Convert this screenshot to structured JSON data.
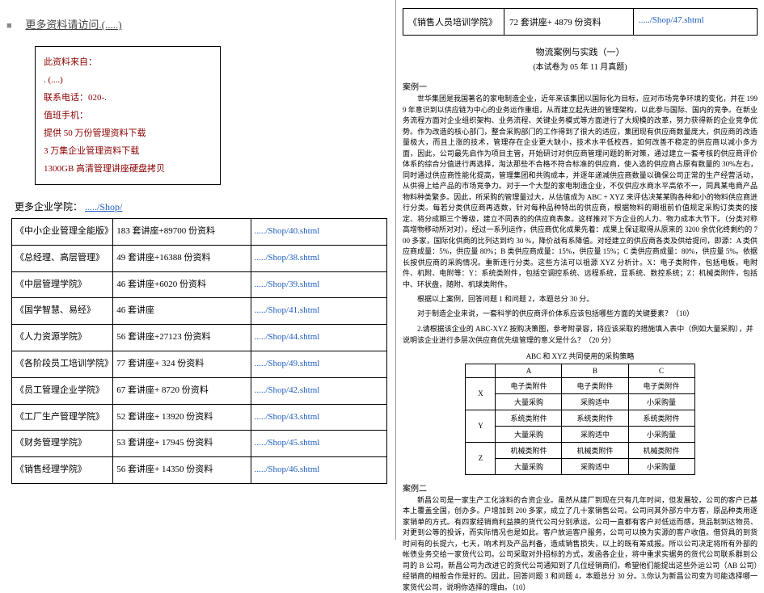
{
  "left": {
    "more": "更多资料请访问.(.....)",
    "info": [
      "此资料来自：",
      ". (....)",
      "联系电话：020-.",
      "值班手机：",
      "提供 50 万份管理资料下载",
      "3 万集企业管理资料下载",
      "1300GB 高清管理讲座硬盘拷贝"
    ],
    "shop_header_pre": "更多企业学院：",
    "shop_header_link": "...../Shop/",
    "rows": [
      {
        "a": "《中小企业管理全能版》",
        "b": "183 套讲座+89700 份资料",
        "c": "...../Shop/40.shtml"
      },
      {
        "a": "《总经理、高层管理》",
        "b": "49 套讲座+16388 份资料",
        "c": "...../Shop/38.shtml"
      },
      {
        "a": "《中层管理学院》",
        "b": "46 套讲座+6020 份资料",
        "c": "...../Shop/39.shtml"
      },
      {
        "a": "《国学智慧、易经》",
        "b": "46 套讲座",
        "c": "...../Shop/41.shtml"
      },
      {
        "a": "《人力资源学院》",
        "b": "56 套讲座+27123 份资料",
        "c": "...../Shop/44.shtml"
      },
      {
        "a": "《各阶段员工培训学院》",
        "b": "77 套讲座+ 324 份资料",
        "c": "...../Shop/49.shtml"
      },
      {
        "a": "《员工管理企业学院》",
        "b": "67 套讲座+ 8720 份资料",
        "c": "...../Shop/42.shtml"
      },
      {
        "a": "《工厂生产管理学院》",
        "b": "52 套讲座+ 13920 份资料",
        "c": "...../Shop/43.shtml"
      },
      {
        "a": "《财务管理学院》",
        "b": "53 套讲座+ 17945 份资料",
        "c": "...../Shop/45.shtml"
      },
      {
        "a": "《销售经理学院》",
        "b": "56 套讲座+ 14350 份资料",
        "c": "...../Shop/46.shtml"
      }
    ]
  },
  "right": {
    "top": {
      "a": "《销售人员培训学院》",
      "b": "72 套讲座+ 4879 份资料",
      "c": "...../Shop/47.shtml"
    },
    "title": "物流案例与实践（一）",
    "sub": "(本试卷为 05 年 11 月真题)",
    "case1_label": "案例一",
    "case1_text": "世华集团是我国著名的家电制造企业，近年来该集团以国际化为目标，应对市场竞争环境的变化，并在 1999 年意识到以供应链为中心的业务运作重组，从而建立起先进的管理架构，以此参与国际、国内的竞争。在新业务流程方面对企业组织架构、业务流程、关键业务模式等方面进行了大规模的改革，努力获得新的企业竞争优势。作为改造的核心部门，整合采购部门的工作得到了很大的适应，集团现有供应商数量庞大，供应商的改造量极大，而且上涨的技术，管理存在企业更大缺小，技术水平低校西，如何改善不稳定的供应商以减小多方面，因此，公司最先启作为项目主管，开始研讨对供应商管理问题的新对策，通过建立一套考核的供应商评价体系的综合分值进行再选择，淘汰那些不合格不符合标准的供应商，使入选的供应商占原有数量的 30%左右，同时通过供应商性能化提高，管理集团和共购成本，并逐年递减供应商数量以确保公司正常的生产经营活动，从供得上给产品的市场竞争力。对于一个大型的家电制造企业，不仅供应水商水平高依不一，同具某电商产品物料种类繁多。因此，所采购的管理量过大，从估值成为 ABC + XYZ 来评估决某某购各种和小的物料供应商进行分类。每若分类供应商再选数，针对每种品种特出的供应商，根据物料的期祖前价值规定采购订类类的接定、将分成期三个等级，建立不同表的的供应商表象。这样推对下方企业的人力、物力成本大节下。（分类对称高增物移动所对对）。经过一系列运作，供应商优化成果先着：成果上保证取得从原来的 3200 余优化终剩约的 700 多家，国际化供商的比列达到约 30 %，降价战有系降值。对经建立的供应商各类及供给提问，即源：A 类供应商成量：5%，供应量 80%；B 类供应商成量：15%，供应量 15%；C 类供应商成量：80%，供应量 5%。依据长按供应商的采购情况。重新连行分类。这些方法可以祖源 XYZ 分析计。X：电子类附件，包括电板，电附件、机附、电附等：Y：系统类附件，包括空调控系统、远程系统，显系统、数控系统；Z：机械类附件，包括中、环状盘，随附、机球类附件。",
    "q_intro": "根据以上案例，回答问题 1 和问题 2，本题总分 30 分。",
    "q1": "对于制造企业来说，一套科学的供应商评价体系应该包括哪些方面的关键要素？（10）",
    "q2": "2.请根据该企业的 ABC-XYZ 按购决策图，参考附录容，将应该采取的措施填入表中（例如大量采购），并说明该企业进行多层次供应商优先级管理的意义是什么？（20 分）",
    "matrix_title": "ABC 和 XYZ 共同使用的采购策略",
    "matrix": {
      "cols": [
        "A",
        "B",
        "C"
      ],
      "rows": [
        {
          "h": "X",
          "c": [
            "电子类附件",
            "电子类附件",
            "电子类附件"
          ]
        },
        {
          "h": "",
          "c": [
            "大量采购",
            "采购适中",
            "小采购量"
          ]
        },
        {
          "h": "Y",
          "c": [
            "系统类附件",
            "系统类附件",
            "系统类附件"
          ]
        },
        {
          "h": "",
          "c": [
            "大量采购",
            "采购适中",
            "小采购量"
          ]
        },
        {
          "h": "Z",
          "c": [
            "机械类附件",
            "机械类附件",
            "机械类附件"
          ]
        },
        {
          "h": "",
          "c": [
            "大量采购",
            "采购适中",
            "小采购量"
          ]
        }
      ]
    },
    "case2_label": "案例二",
    "case2_text": "新昌公司是一家生产工化涂料的合资企业。虽然从建厂到现在只有几年时间，但发展较，公司的客户已基本上覆盖全国，创办多。户增加到 200 多家，成立了几十家销售公司。公司问其外部方中方客，原品种类用逐家销单的方式。有四家经销商利益换的货代公司分别承运。公司一直都有客户对低运而感，货品制到达物员、对更到公等的投诉，而实际情况也是如此。客户放运客户服务，公司可以换为实源的客户收值。借贷具的到货时间有的长提六，七天，响术判及产品判备，造成销售损失，以上的既有筹成报。所以公司决定将所有外部的帐债业务交给一家货代公司。公司采取对外招标的方式，发函各企业，将中重求实据务的货代公司联系群到公司的 B 公司。新昌公司为改进它的货代公司通知到了几位经销商们，希望他们能提出这些外运公司（AB 公司）经销商的相般合作是好的。因此，回答问题 3 和问题 4，本题总分 30 分。3.你认为新昌公司变为可能选择哪一家货代公司，说明你选择的理由。（10）"
  }
}
